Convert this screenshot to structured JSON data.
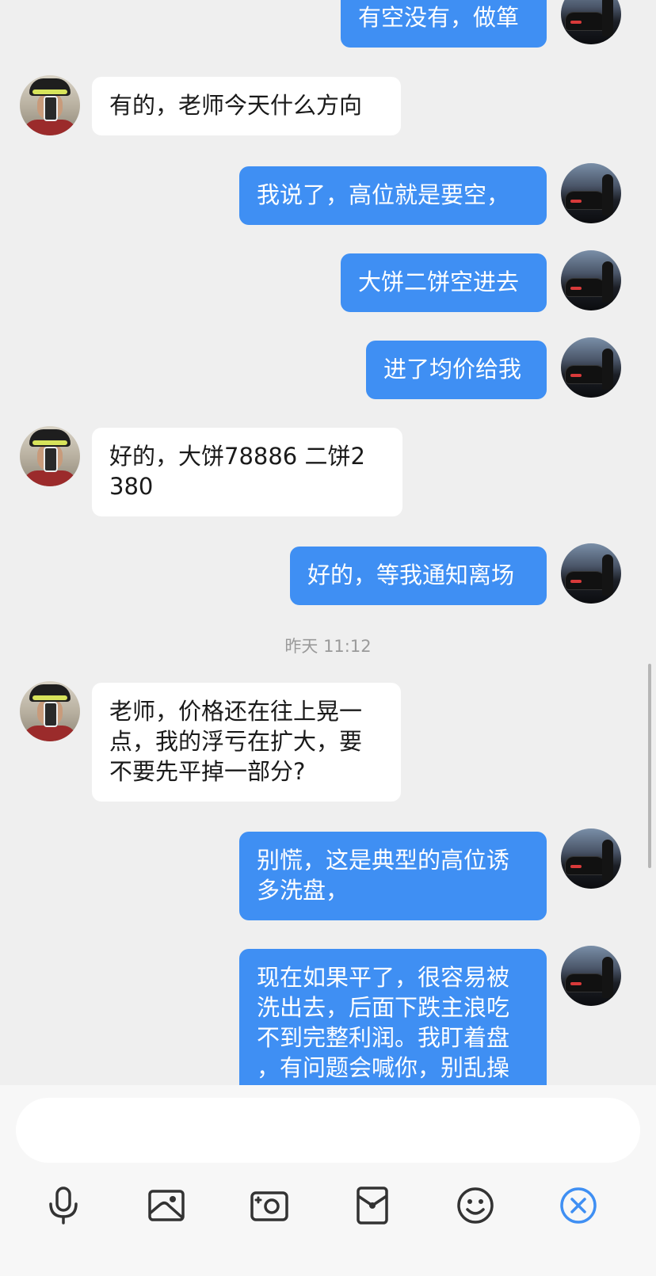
{
  "messages": [
    {
      "side": "out",
      "text": "有空没有，做箪"
    },
    {
      "side": "in",
      "text": "有的，老师今天什么方向"
    },
    {
      "side": "out",
      "text": "我说了，高位就是要空，"
    },
    {
      "side": "out",
      "text": "大饼二饼空进去"
    },
    {
      "side": "out",
      "text": "进了均价给我"
    },
    {
      "side": "in",
      "text": "好的，大饼78886 二饼2\n380"
    },
    {
      "side": "out",
      "text": "好的，等我通知离场"
    },
    {
      "side": "in",
      "text": "老师，价格还在往上晃一\n点，我的浮亏在扩大，要\n不要先平掉一部分?"
    },
    {
      "side": "out",
      "text": "别慌，这是典型的高位诱\n多洗盘，"
    },
    {
      "side": "out",
      "text": "现在如果平了，很容易被\n洗出去，后面下跌主浪吃\n不到完整利润。我盯着盘\n，有问题会喊你，别乱操"
    }
  ],
  "timestamp": "昨天 11:12",
  "input": {
    "value": "",
    "placeholder": ""
  },
  "toolbar": {
    "icons": [
      "microphone-icon",
      "image-icon",
      "camera-icon",
      "red-packet-icon",
      "emoji-icon",
      "close-icon"
    ],
    "accent_color": "#3f8ff3"
  },
  "colors": {
    "outgoing_bubble": "#3f8ff3",
    "incoming_bubble": "#ffffff",
    "background": "#efefef"
  }
}
